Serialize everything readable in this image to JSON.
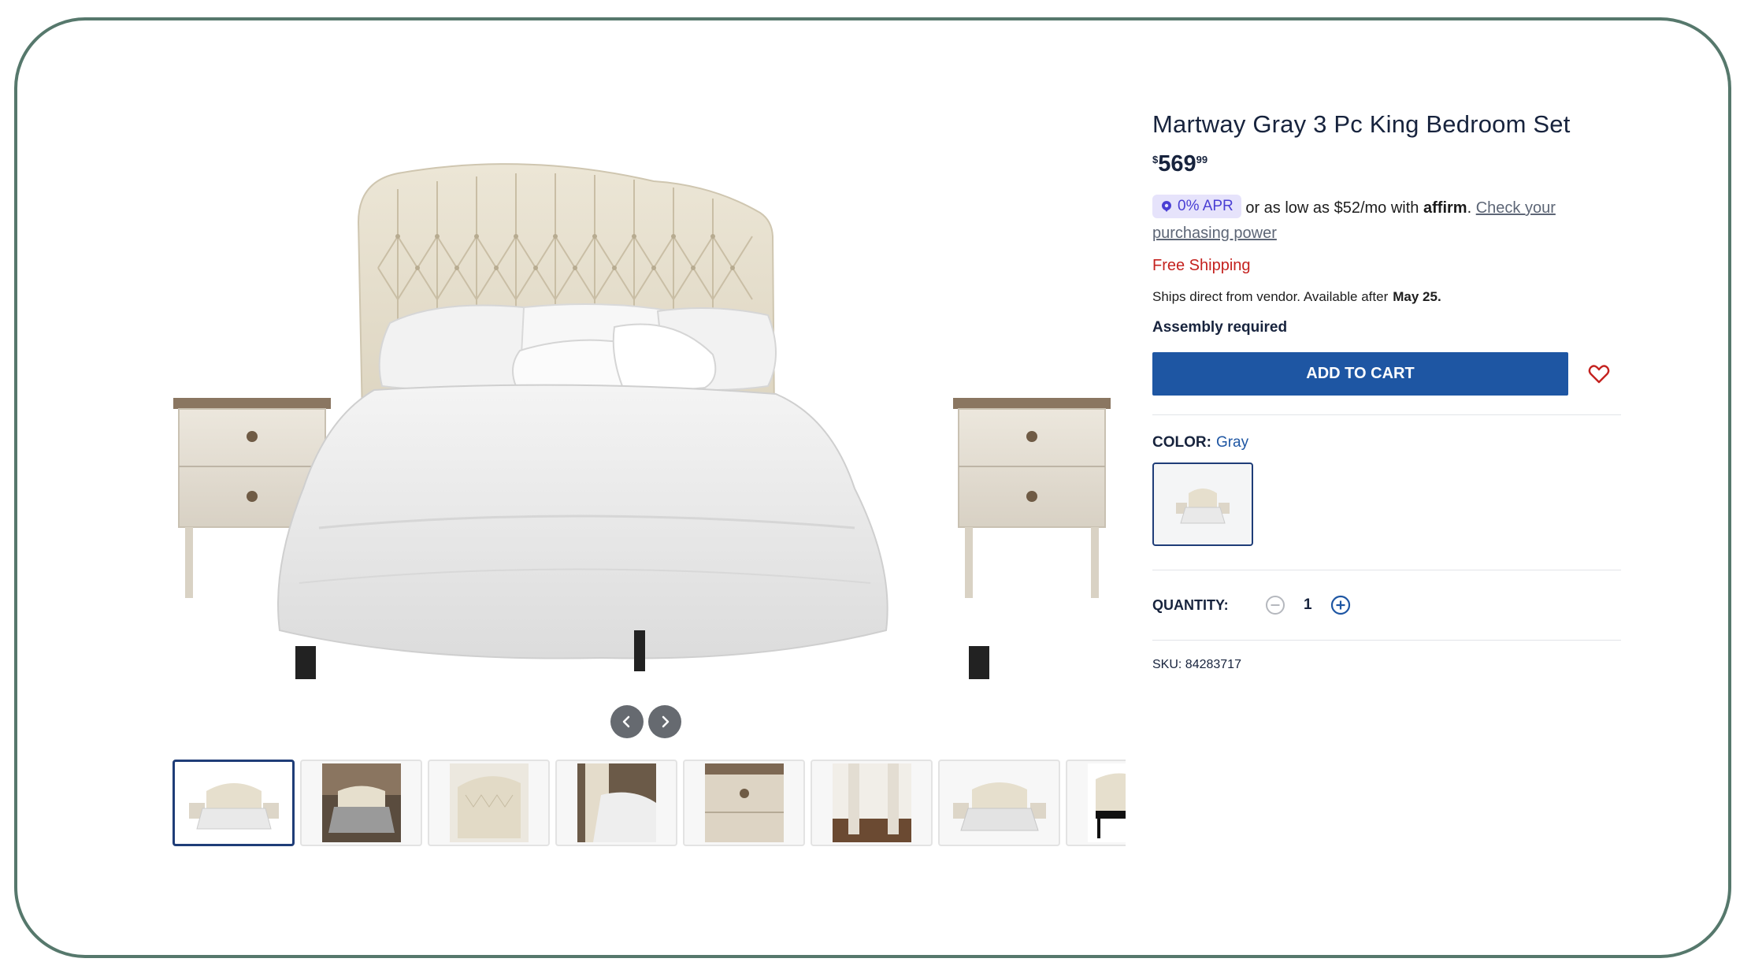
{
  "product": {
    "title": "Martway Gray 3 Pc King Bedroom Set",
    "price": {
      "currency": "$",
      "dollars": "569",
      "cents": "99"
    },
    "financing": {
      "badge": "0% APR",
      "text": "or as low as $52/mo with",
      "brand": "affirm",
      "link": "Check your purchasing power"
    },
    "shipping": "Free Shipping",
    "ships_text": "Ships direct from vendor. Available after",
    "ships_date": "May 25.",
    "assembly": "Assembly required",
    "add_to_cart_label": "ADD TO CART",
    "color": {
      "label": "COLOR:",
      "value": "Gray"
    },
    "quantity": {
      "label": "QUANTITY:",
      "value": "1"
    },
    "sku": "SKU: 84283717"
  },
  "gallery": {
    "thumbnails": [
      {
        "name": "thumb-bed-front",
        "selected": true
      },
      {
        "name": "thumb-bed-room",
        "selected": false
      },
      {
        "name": "thumb-headboard",
        "selected": false
      },
      {
        "name": "thumb-bed-corner",
        "selected": false
      },
      {
        "name": "thumb-nightstand-drawer",
        "selected": false
      },
      {
        "name": "thumb-nightstand-legs",
        "selected": false
      },
      {
        "name": "thumb-bed-set",
        "selected": false
      },
      {
        "name": "thumb-bed-frame",
        "selected": false
      }
    ]
  },
  "colors": {
    "accent": "#1e56a3",
    "selected_border": "#1f3d78",
    "free_shipping": "#c4221f",
    "frame_border": "#56786c",
    "apr_badge_bg": "#e6e3fb",
    "apr_badge_text": "#4a3fd4"
  },
  "icons": {
    "prev": "chevron-left-icon",
    "next": "chevron-right-icon",
    "wishlist": "heart-icon",
    "decrease": "minus-circle-icon",
    "increase": "plus-circle-icon",
    "affirm_badge": "affirm-tag-icon"
  }
}
